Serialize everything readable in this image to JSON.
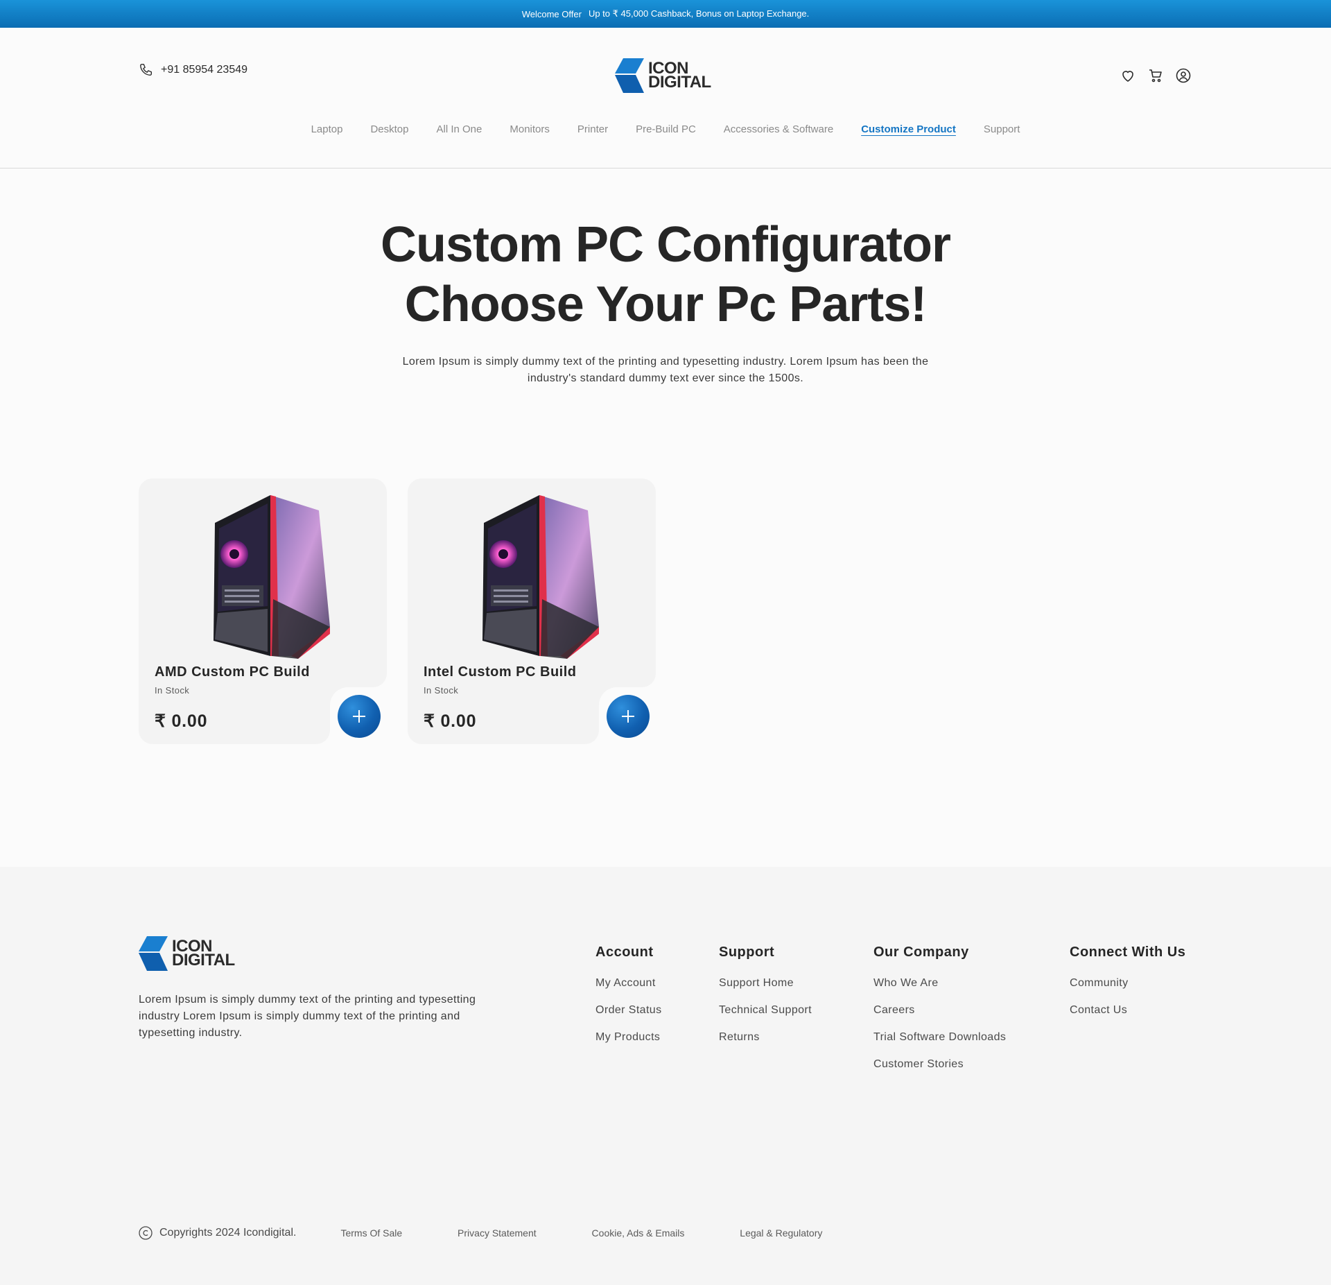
{
  "offer": {
    "title": "Welcome Offer",
    "text": "Up to ₹ 45,000 Cashback, Bonus on Laptop Exchange."
  },
  "header": {
    "phone": "+91 85954 23549",
    "logo_line1": "ICON",
    "logo_line2": "DIGITAL",
    "nav": [
      "Laptop",
      "Desktop",
      "All In One",
      "Monitors",
      "Printer",
      "Pre-Build PC",
      "Accessories & Software",
      "Customize Product",
      "Support"
    ],
    "active_nav": "Customize Product"
  },
  "hero": {
    "title_line1": "Custom PC Configurator",
    "title_line2": "Choose Your Pc Parts!",
    "description": "Lorem Ipsum is simply dummy text of the printing and typesetting industry. Lorem Ipsum has been the industry's standard dummy text ever since the 1500s."
  },
  "products": [
    {
      "name": "AMD Custom PC Build",
      "stock": "In Stock",
      "price": "₹ 0.00",
      "image": "pc-case-image"
    },
    {
      "name": "Intel Custom PC Build",
      "stock": "In Stock",
      "price": "₹ 0.00",
      "image": "pc-case-image"
    }
  ],
  "footer": {
    "logo_line1": "ICON",
    "logo_line2": "DIGITAL",
    "description": "Lorem Ipsum is simply dummy text of the printing and typesetting industry Lorem Ipsum is simply dummy text of the printing and typesetting industry.",
    "columns": [
      {
        "title": "Account",
        "links": [
          "My Account",
          "Order Status",
          "My Products"
        ]
      },
      {
        "title": "Support",
        "links": [
          "Support Home",
          "Technical Support",
          "Returns"
        ]
      },
      {
        "title": "Our Company",
        "links": [
          "Who We Are",
          "Careers",
          "Trial Software Downloads",
          "Customer Stories"
        ]
      },
      {
        "title": "Connect With Us",
        "links": [
          "Community",
          "Contact Us"
        ]
      }
    ],
    "copyright": "Copyrights 2024 Icondigital.",
    "legal_links": [
      "Terms Of Sale",
      "Privacy Statement",
      "Cookie, Ads & Emails",
      "Legal & Regulatory"
    ]
  },
  "colors": {
    "brand_blue": "#1576c4",
    "topbar": "#0b6db3",
    "text_dark": "#262626"
  },
  "icons": [
    "phone-icon",
    "heart-icon",
    "cart-icon",
    "user-icon",
    "plus-icon",
    "copyright-icon"
  ]
}
